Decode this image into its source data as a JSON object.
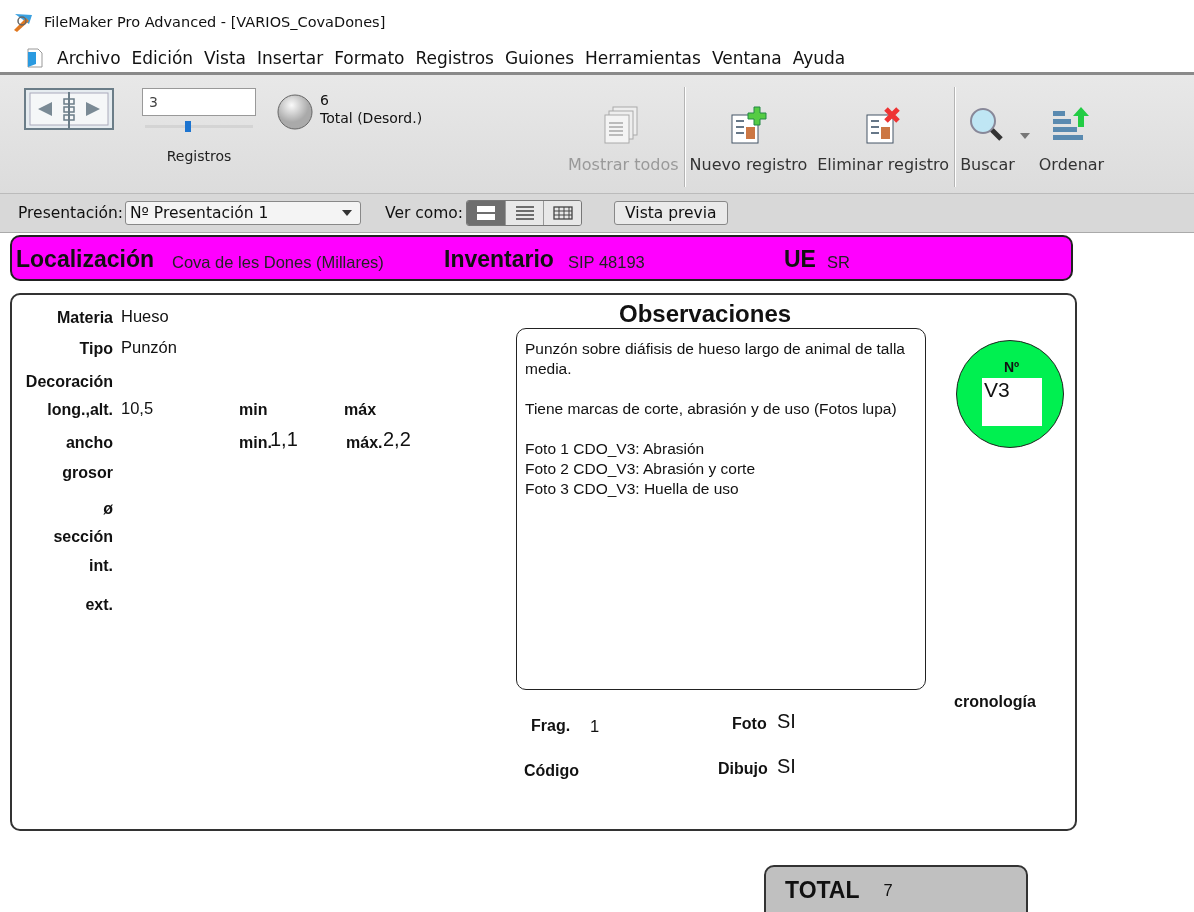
{
  "window": {
    "title": "FileMaker Pro Advanced - [VARIOS_CovaDones]"
  },
  "menu": [
    "Archivo",
    "Edición",
    "Vista",
    "Insertar",
    "Formato",
    "Registros",
    "Guiones",
    "Herramientas",
    "Ventana",
    "Ayuda"
  ],
  "toolbar": {
    "record_number": "3",
    "record_slider": {
      "level": 0.4
    },
    "found_count": "6",
    "total_label": "Total (Desord.)",
    "records_label": "Registros",
    "buttons": [
      {
        "kind": "show-all",
        "label": "Mostrar todos",
        "disabled": true
      },
      {
        "kind": "new",
        "label": "Nuevo registro",
        "disabled": false
      },
      {
        "kind": "delete",
        "label": "Eliminar registro",
        "disabled": false
      },
      {
        "kind": "find",
        "label": "Buscar",
        "disabled": false
      },
      {
        "kind": "sort",
        "label": "Ordenar",
        "disabled": false
      }
    ]
  },
  "layout_bar": {
    "layout_label": "Presentación:",
    "layout": "Nº Presentación 1",
    "view_label": "Ver como:",
    "views": [
      {
        "kind": "form",
        "selected": true
      },
      {
        "kind": "list",
        "selected": false
      },
      {
        "kind": "table",
        "selected": false
      }
    ],
    "preview_button": "Vista previa"
  },
  "header": [
    {
      "label": "Localización",
      "value": "Cova de les Dones (Millares)"
    },
    {
      "label": "Inventario",
      "value": "SIP 48193"
    },
    {
      "label": "UE",
      "value": "SR"
    }
  ],
  "fields": [
    {
      "label": "Materia",
      "value": "Hueso"
    },
    {
      "label": "Tipo",
      "value": "Punzón"
    },
    {
      "label": "Decoración"
    },
    {
      "label": "long.,alt.",
      "value": "10,5"
    },
    {
      "label": "ancho"
    },
    {
      "label": "grosor"
    },
    {
      "label": "ø"
    },
    {
      "label": "sección"
    },
    {
      "label": "int."
    },
    {
      "label": "ext."
    }
  ],
  "dimension_headers": [
    "min",
    "máx"
  ],
  "width_range": [
    {
      "label": "min.",
      "value": "1,1"
    },
    {
      "label": "máx.",
      "value": "2,2"
    }
  ],
  "observations": {
    "title": "Observaciones",
    "paragraphs": [
      "Punzón sobre diáfisis de hueso largo de animal de talla media.",
      "Tiene marcas de corte, abrasión y de uso (Fotos lupa)",
      "Foto 1 CDO_V3: Abrasión\nFoto 2 CDO_V3: Abrasión y corte\nFoto 3 CDO_V3: Huella de uso"
    ]
  },
  "number_badge": {
    "label": "Nº",
    "value": "V3",
    "color": "#00f050"
  },
  "chronology_label": "cronología",
  "bottom_fields": [
    {
      "label": "Frag.",
      "value": "1"
    },
    {
      "label": "Foto",
      "value": "SI"
    },
    {
      "label": "Código"
    },
    {
      "label": "Dibujo",
      "value": "SI"
    }
  ],
  "total": {
    "label": "TOTAL",
    "value": "7"
  }
}
